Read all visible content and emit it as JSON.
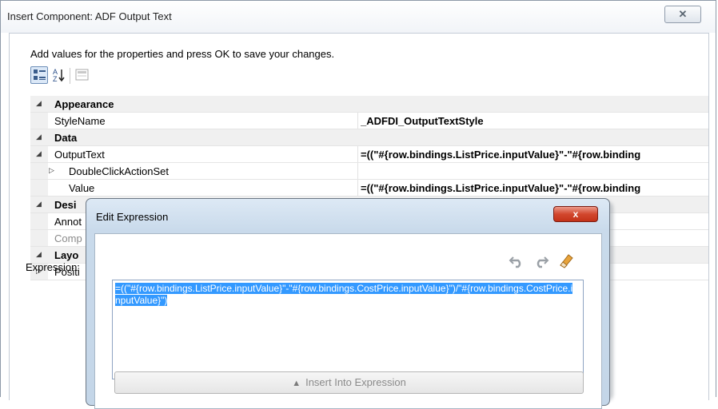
{
  "dialog": {
    "title": "Insert Component: ADF Output Text",
    "close_label": "✕",
    "instructions": "Add values for the properties and press OK to save your changes."
  },
  "properties": {
    "rows": [
      {
        "type": "category",
        "expanded": true,
        "name": "Appearance",
        "value": ""
      },
      {
        "type": "prop",
        "name": "StyleName",
        "value": "_ADFDI_OutputTextStyle"
      },
      {
        "type": "category",
        "expanded": true,
        "name": "Data",
        "value": ""
      },
      {
        "type": "prop",
        "tree": "open",
        "name": "OutputText",
        "value": "=((\"#{row.bindings.ListPrice.inputValue}\"-\"#{row.binding"
      },
      {
        "type": "prop",
        "tree": "closed",
        "indent": 2,
        "name": "DoubleClickActionSet",
        "value": ""
      },
      {
        "type": "prop",
        "indent": 1,
        "name": "Value",
        "value": "=((\"#{row.bindings.ListPrice.inputValue}\"-\"#{row.binding"
      },
      {
        "type": "category",
        "expanded": true,
        "name": "Desi",
        "value": ""
      },
      {
        "type": "prop",
        "name": "Annot",
        "value": ""
      },
      {
        "type": "prop",
        "gray": true,
        "name": "Comp",
        "value": ""
      },
      {
        "type": "category",
        "expanded": true,
        "name": "Layo",
        "value": ""
      },
      {
        "type": "prop",
        "tree": "closed",
        "name": "Positi",
        "value": ""
      }
    ]
  },
  "edit_expression": {
    "title": "Edit Expression",
    "close_label": "x",
    "label": "Expression:",
    "text": "=((\"#{row.bindings.ListPrice.inputValue}\"-\"#{row.bindings.CostPrice.inputValue}\")/\"#{row.bindings.CostPrice.inputValue}\")",
    "insert_button": "Insert Into Expression"
  }
}
